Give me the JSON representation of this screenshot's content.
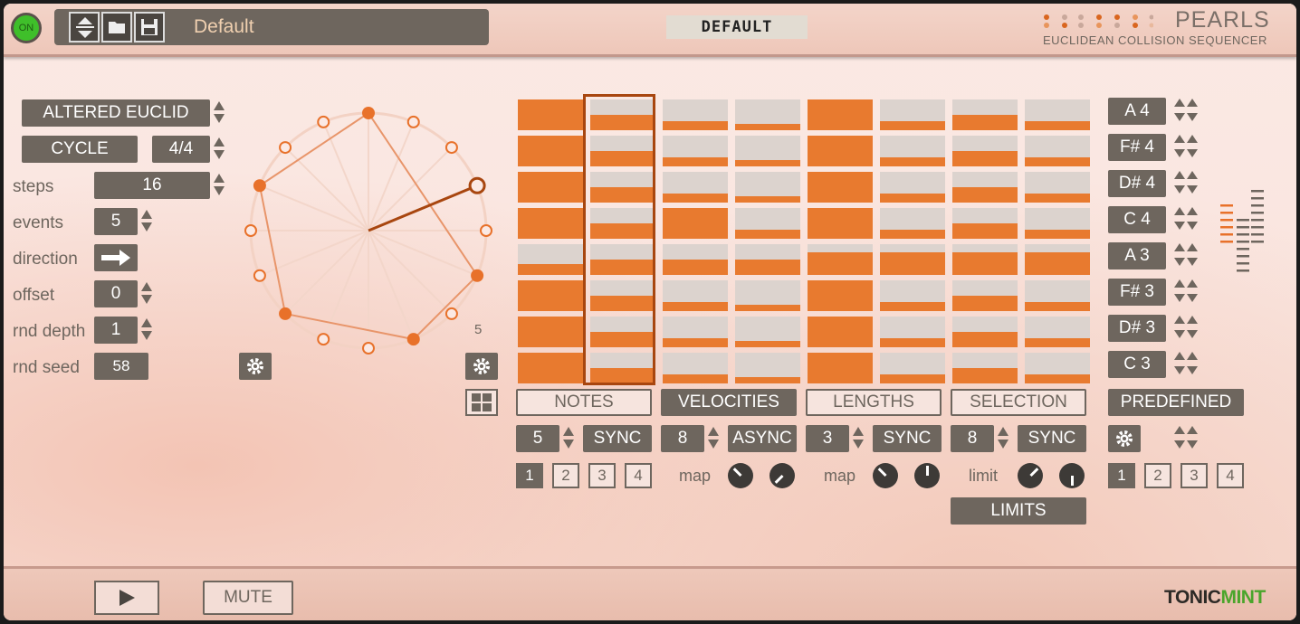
{
  "header": {
    "power_label": "ON",
    "preset_name": "Default",
    "scale_tag": "DEFAULT",
    "brand_title": "PEARLS",
    "brand_subtitle": "EUCLIDEAN COLLISION SEQUENCER"
  },
  "left_panel": {
    "mode": "ALTERED EUCLID",
    "cycle_label": "CYCLE",
    "time_sig": "4/4",
    "steps_label": "steps",
    "steps_value": "16",
    "events_label": "events",
    "events_value": "5",
    "direction_label": "direction",
    "offset_label": "offset",
    "offset_value": "0",
    "rnd_depth_label": "rnd depth",
    "rnd_depth_value": "1",
    "rnd_seed_label": "rnd seed",
    "rnd_seed_value": "58"
  },
  "circle": {
    "steps": 16,
    "count_label": "5"
  },
  "sections": [
    {
      "title": "NOTES",
      "value": "5",
      "mode": "SYNC"
    },
    {
      "title": "VELOCITIES",
      "value": "8",
      "mode": "ASYNC",
      "map_label": "map"
    },
    {
      "title": "LENGTHS",
      "value": "3",
      "mode": "SYNC",
      "map_label": "map"
    },
    {
      "title": "SELECTION",
      "value": "8",
      "mode": "SYNC",
      "map_label": "limit",
      "limits_label": "LIMITS"
    }
  ],
  "grid_levels": [
    [
      1.0,
      0.5,
      0.3,
      0.2,
      1.0,
      0.3,
      0.5,
      0.3
    ],
    [
      1.0,
      0.5,
      0.3,
      0.2,
      1.0,
      0.3,
      0.5,
      0.3
    ],
    [
      1.0,
      0.5,
      0.3,
      0.2,
      1.0,
      0.3,
      0.5,
      0.3
    ],
    [
      1.0,
      0.5,
      1.0,
      0.3,
      1.0,
      0.3,
      0.5,
      0.3
    ],
    [
      0.35,
      0.5,
      0.5,
      0.5,
      0.75,
      0.75,
      0.75,
      0.75
    ],
    [
      1.0,
      0.5,
      0.3,
      0.2,
      1.0,
      0.3,
      0.5,
      0.3
    ],
    [
      1.0,
      0.5,
      0.3,
      0.2,
      1.0,
      0.3,
      0.5,
      0.3
    ],
    [
      1.0,
      0.5,
      0.3,
      0.2,
      1.0,
      0.3,
      0.5,
      0.3
    ]
  ],
  "step_pages": [
    "1",
    "2",
    "3",
    "4"
  ],
  "predefined": {
    "notes": [
      "A 4",
      "F# 4",
      "D# 4",
      "C 4",
      "A 3",
      "F# 3",
      "D# 3",
      "C 3"
    ],
    "label": "PREDEFINED"
  },
  "footer": {
    "mute_label": "MUTE",
    "brand_a": "TONIC",
    "brand_b": "MINT"
  },
  "colors": {
    "accent": "#e87a2f",
    "panel": "#6e665e",
    "power": "#3fbf2a",
    "brand_mint": "#4aa52b"
  }
}
